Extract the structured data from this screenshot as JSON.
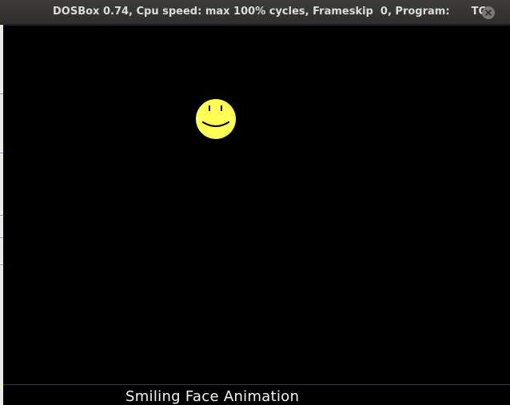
{
  "window": {
    "title": "DOSBox 0.74, Cpu speed: max 100% cycles, Frameskip  0, Program:      TC",
    "close_icon": "close-icon"
  },
  "screen": {
    "background": "#000000",
    "face": {
      "color": "#ffff55",
      "icon": "smiley-face-icon"
    },
    "caption": "Smiling Face Animation"
  }
}
